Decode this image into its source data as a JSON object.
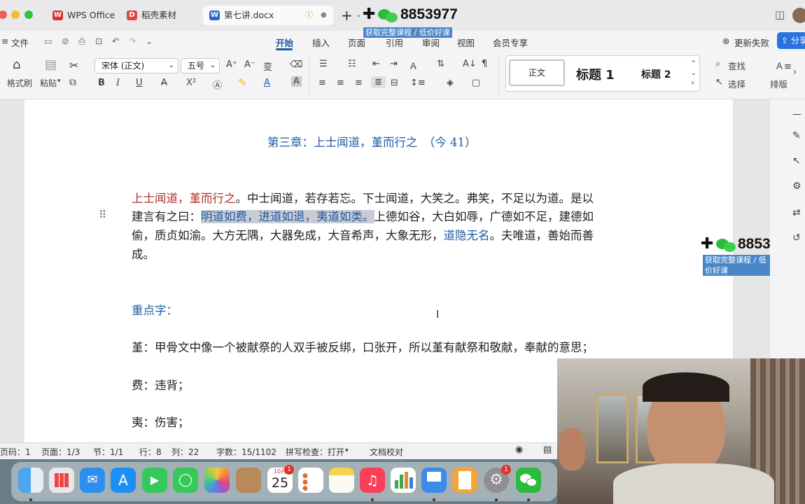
{
  "tabs": [
    {
      "label": "WPS Office",
      "icon": "wps-icon"
    },
    {
      "label": "稻壳素材",
      "icon": "docer-icon"
    },
    {
      "label": "第七讲.docx",
      "icon": "word-doc-icon"
    }
  ],
  "watermark": {
    "number": "8853977",
    "subtitle": "获取完整课程 / 低价好课"
  },
  "menu": {
    "file": "文件",
    "tabs": [
      "开始",
      "插入",
      "页面",
      "引用",
      "审阅",
      "视图",
      "会员专享"
    ],
    "active_tab": "开始",
    "update_failed": "更新失败",
    "share": "分享"
  },
  "ribbon": {
    "format_painter": "格式刷",
    "paste": "粘贴",
    "font_name": "宋体 (正文)",
    "font_size": "五号",
    "style_normal": "正文",
    "style_h1": "标题 1",
    "style_h2": "标题 2",
    "find": "查找",
    "select": "选择",
    "layout": "排版"
  },
  "document": {
    "title": "第三章：上士闻道，堇而行之　（今 41）",
    "p1_red1": "上士闻道，",
    "p1_red2": "堇而行之",
    "p1_rest": "。中士闻道，若存若忘。下士闻道，大笑之。弗笑，不足以为道。是以",
    "p2_a": "建言有之曰：",
    "p2_hl": "明道如费，进道如退，夷道如类。",
    "p2_b": "上德如谷，大白如辱，广德如不足，建德如",
    "p3_a": "偷，质贞如渝。大方无隅，大器免成，大音希声，大象无形，",
    "p3_blue": "道隐无名",
    "p3_b": "。夫唯道，善始而善",
    "p4": "成。",
    "keywords_heading": "重点字：",
    "kw1": "堇：甲骨文中像一个被献祭的人双手被反绑，口张开，所以堇有献祭和敬献，奉献的意思；",
    "kw2": "费：违背；",
    "kw3": "夷：伤害；"
  },
  "status": {
    "page_code": "页码：1",
    "page": "页面：1/3",
    "section": "节：1/1",
    "row": "行：8",
    "col": "列：22",
    "words": "字数：15/1102",
    "spell": "拼写检查：打开",
    "proof": "文档校对"
  },
  "dock": {
    "calendar_month": "10月",
    "calendar_day": "25",
    "calendar_badge": "1",
    "settings_badge": "1"
  },
  "colors": {
    "accent": "#1f5aa3",
    "red_text": "#b0302a",
    "wps_red": "#d8332c"
  }
}
